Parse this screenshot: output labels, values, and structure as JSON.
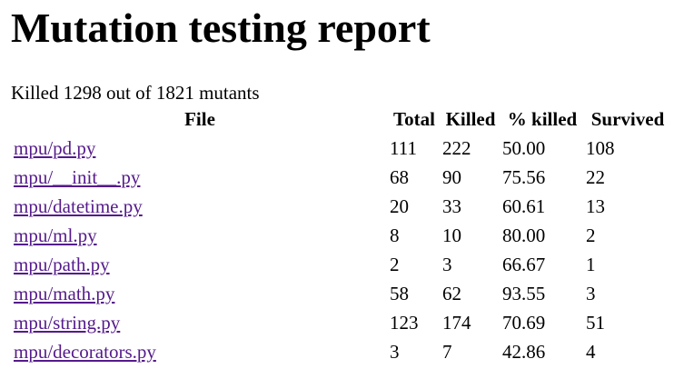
{
  "title": "Mutation testing report",
  "summary": "Killed 1298 out of 1821 mutants",
  "table": {
    "headers": {
      "file": "File",
      "total": "Total",
      "killed": "Killed",
      "pct_killed": "% killed",
      "survived": "Survived"
    },
    "rows": [
      {
        "file": "mpu/pd.py",
        "total": "111",
        "killed": "222",
        "pct_killed": "50.00",
        "survived": "108"
      },
      {
        "file": "mpu/__init__.py",
        "total": "68",
        "killed": "90",
        "pct_killed": "75.56",
        "survived": "22"
      },
      {
        "file": "mpu/datetime.py",
        "total": "20",
        "killed": "33",
        "pct_killed": "60.61",
        "survived": "13"
      },
      {
        "file": "mpu/ml.py",
        "total": "8",
        "killed": "10",
        "pct_killed": "80.00",
        "survived": "2"
      },
      {
        "file": "mpu/path.py",
        "total": "2",
        "killed": "3",
        "pct_killed": "66.67",
        "survived": "1"
      },
      {
        "file": "mpu/math.py",
        "total": "58",
        "killed": "62",
        "pct_killed": "93.55",
        "survived": "3"
      },
      {
        "file": "mpu/string.py",
        "total": "123",
        "killed": "174",
        "pct_killed": "70.69",
        "survived": "51"
      },
      {
        "file": "mpu/decorators.py",
        "total": "3",
        "killed": "7",
        "pct_killed": "42.86",
        "survived": "4"
      }
    ]
  },
  "colors": {
    "link_visited": "#551a8b",
    "text": "#000000",
    "background": "#ffffff"
  }
}
